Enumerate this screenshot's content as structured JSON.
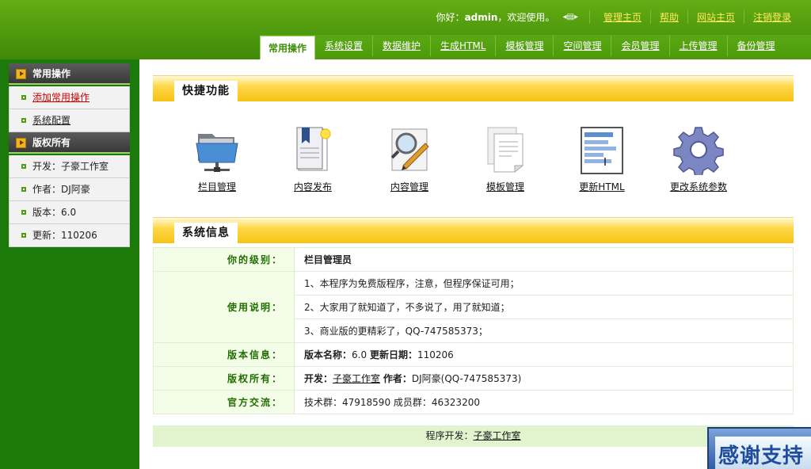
{
  "topbar": {
    "greeting": "你好：",
    "username": "admin",
    "welcome": "，欢迎使用。",
    "links": [
      "管理主页",
      "帮助",
      "网站主页",
      "注销登录"
    ]
  },
  "mainnav": {
    "tabs": [
      "常用操作",
      "系统设置",
      "数据维护",
      "生成HTML",
      "模板管理",
      "空间管理",
      "会员管理",
      "上传管理",
      "备份管理"
    ],
    "active": "常用操作"
  },
  "sidebar": {
    "section1_title": "常用操作",
    "section1_items": [
      "添加常用操作",
      "系统配置"
    ],
    "section2_title": "版权所有",
    "section2_items": [
      "开发：子豪工作室",
      "作者：DJ阿豪",
      "版本：6.0",
      "更新：110206"
    ]
  },
  "shortcuts": {
    "title": "快捷功能",
    "items": [
      {
        "label": "栏目管理",
        "icon": "folder-network-icon"
      },
      {
        "label": "内容发布",
        "icon": "document-publish-icon"
      },
      {
        "label": "内容管理",
        "icon": "magnifier-edit-icon"
      },
      {
        "label": "模板管理",
        "icon": "template-pages-icon"
      },
      {
        "label": "更新HTML",
        "icon": "html-page-icon"
      },
      {
        "label": "更改系统参数",
        "icon": "gear-icon"
      }
    ]
  },
  "sysinfo": {
    "title": "系统信息",
    "level_key": "你的级别：",
    "level_value": "栏目管理员",
    "usage_key": "使用说明：",
    "usage_lines": [
      "1、本程序为免费版程序，注意，但程序保证可用；",
      "2、大家用了就知道了，不多说了，用了就知道；",
      "3、商业版的更精彩了，QQ-747585373；"
    ],
    "version_key": "版本信息：",
    "version_name_label": "版本名称：",
    "version_name": "6.0",
    "update_label": "更新日期：",
    "update_date": "110206",
    "copyright_key": "版权所有：",
    "dev_label": "开发：",
    "dev_value": "子豪工作室",
    "author_label": "作者：",
    "author_value": "DJ阿豪(QQ-747585373)",
    "exchange_key": "官方交流：",
    "exchange_value": "技术群：47918590 成员群：46323200"
  },
  "footer": {
    "label": "程序开发：",
    "link": "子豪工作室"
  },
  "thanks_badge": "感谢支持",
  "colors": {
    "header_green": "#4f9a0d",
    "sidebar_green": "#1b7a0a",
    "section_yellow": "#ffd84a",
    "link_yellow": "#ffe95c",
    "key_green": "#1e6e00"
  }
}
